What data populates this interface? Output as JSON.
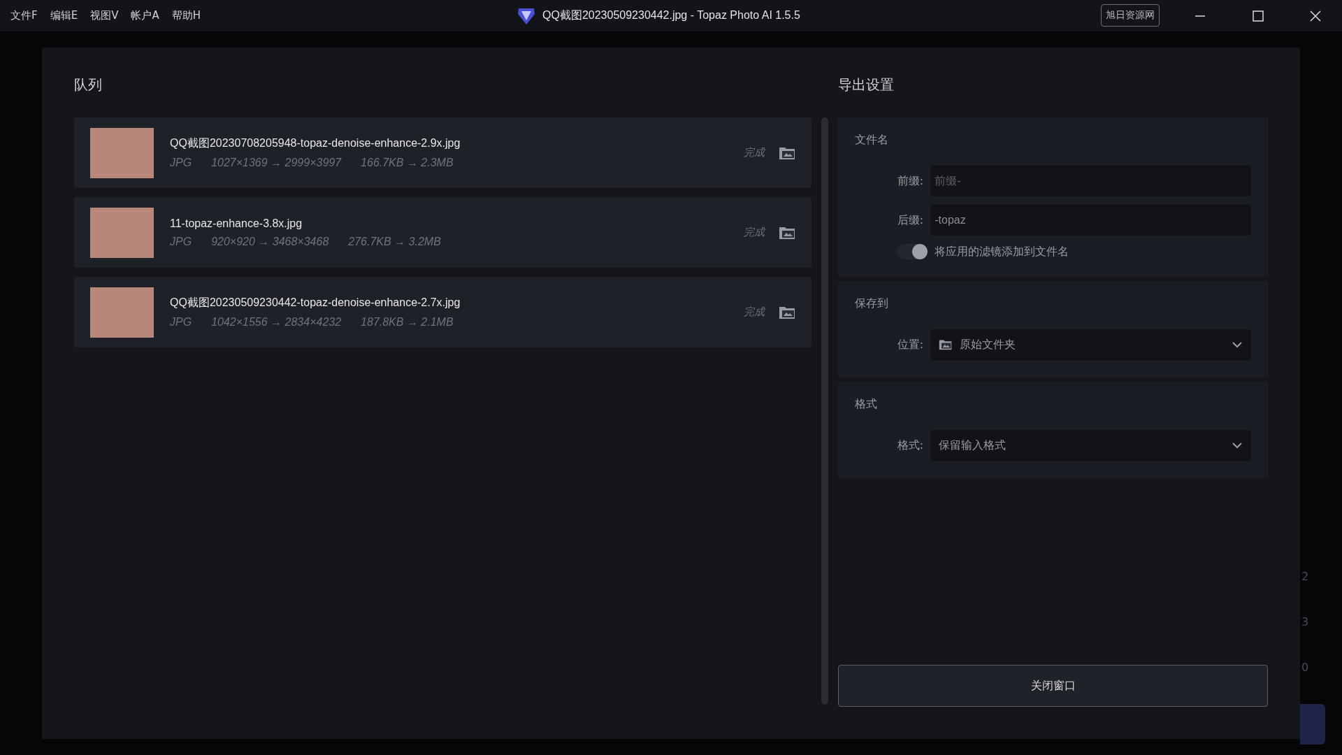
{
  "menu": [
    {
      "label": "文件F"
    },
    {
      "label": "编辑E"
    },
    {
      "label": "视图V"
    },
    {
      "label": "帐户A"
    },
    {
      "label": "帮助H"
    }
  ],
  "window": {
    "title": "QQ截图20230509230442.jpg - Topaz Photo AI 1.5.5",
    "badge": "旭日资源网"
  },
  "queue": {
    "title": "队列",
    "items": [
      {
        "name": "QQ截图20230708205948-topaz-denoise-enhance-2.9x.jpg",
        "format": "JPG",
        "dims": "1027×1369 → 2999×3997",
        "size": "166.7KB → 2.3MB",
        "status": "完成"
      },
      {
        "name": "11-topaz-enhance-3.8x.jpg",
        "format": "JPG",
        "dims": "920×920 → 3468×3468",
        "size": "276.7KB → 3.2MB",
        "status": "完成"
      },
      {
        "name": "QQ截图20230509230442-topaz-denoise-enhance-2.7x.jpg",
        "format": "JPG",
        "dims": "1042×1556 → 2834×4232",
        "size": "187.8KB → 2.1MB",
        "status": "完成"
      }
    ]
  },
  "export": {
    "title": "导出设置",
    "sections": [
      {
        "title": "文件名",
        "rows": [
          {
            "kind": "input",
            "label": "前缀:",
            "placeholder": "前缀-"
          },
          {
            "kind": "input",
            "label": "后缀:",
            "value": "-topaz"
          },
          {
            "kind": "toggle",
            "label": "将应用的滤镜添加到文件名",
            "on": true
          }
        ]
      },
      {
        "title": "保存到",
        "rows": [
          {
            "kind": "select",
            "label": "位置:",
            "value": "原始文件夹",
            "icon": true
          }
        ]
      },
      {
        "title": "格式",
        "rows": [
          {
            "kind": "select",
            "label": "格式:",
            "value": "保留输入格式",
            "icon": false
          }
        ]
      }
    ],
    "close_button": "关闭窗口"
  },
  "background_digits": [
    "2",
    "3",
    "0"
  ]
}
